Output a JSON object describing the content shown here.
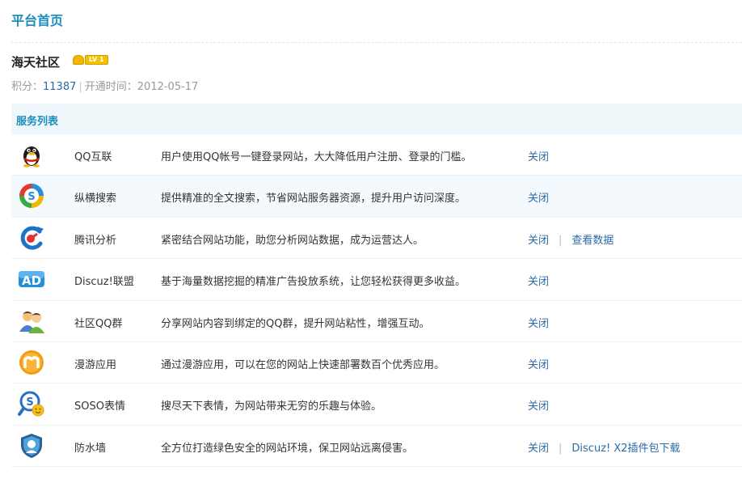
{
  "header": {
    "title": "平台首页"
  },
  "site": {
    "name": "海天社区",
    "level_badge": "LV 1",
    "points_label": "积分：",
    "points": "11387",
    "separator": "|",
    "opened_label": "开通时间：",
    "opened_date": "2012-05-17"
  },
  "services": {
    "heading": "服务列表",
    "items": [
      {
        "icon": "qq-penguin-icon",
        "name": "QQ互联",
        "desc": "用户使用QQ帐号一键登录网站，大大降低用户注册、登录的门槛。",
        "action": "关闭"
      },
      {
        "icon": "soso-search-icon",
        "name": "纵横搜索",
        "desc": "提供精准的全文搜索，节省网站服务器资源，提升用户访问深度。",
        "action": "关闭"
      },
      {
        "icon": "tencent-analytics-icon",
        "name": "腾讯分析",
        "desc": "紧密结合网站功能，助您分析网站数据，成为运营达人。",
        "action": "关闭",
        "extra": "查看数据"
      },
      {
        "icon": "ad-union-icon",
        "name": "Discuz!联盟",
        "desc": "基于海量数据挖掘的精准广告投放系统，让您轻松获得更多收益。",
        "action": "关闭"
      },
      {
        "icon": "qq-group-users-icon",
        "name": "社区QQ群",
        "desc": "分享网站内容到绑定的QQ群，提升网站粘性，增强互动。",
        "action": "关闭"
      },
      {
        "icon": "manyou-app-icon",
        "name": "漫游应用",
        "desc": "通过漫游应用，可以在您的网站上快速部署数百个优秀应用。",
        "action": "关闭"
      },
      {
        "icon": "soso-emoticon-icon",
        "name": "SOSO表情",
        "desc": "搜尽天下表情，为网站带来无穷的乐趣与体验。",
        "action": "关闭"
      },
      {
        "icon": "firewall-shield-icon",
        "name": "防水墙",
        "desc": "全方位打造绿色安全的网站环境，保卫网站远离侵害。",
        "action": "关闭",
        "extra": "Discuz! X2插件包下载"
      }
    ]
  }
}
